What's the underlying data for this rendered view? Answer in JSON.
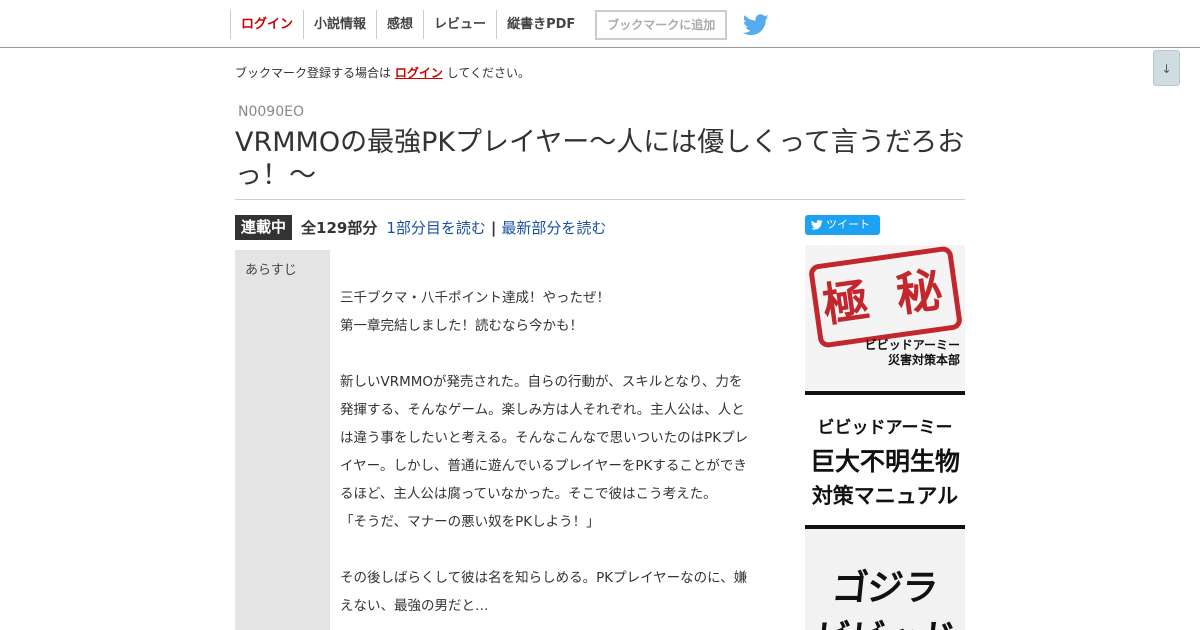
{
  "nav": {
    "items": [
      {
        "label": "ログイン"
      },
      {
        "label": "小説情報"
      },
      {
        "label": "感想"
      },
      {
        "label": "レビュー"
      },
      {
        "label": "縦書きPDF"
      }
    ],
    "bookmark_button": "ブックマークに追加",
    "twitter_icon": "twitter-bird-icon"
  },
  "scroll_button": "↓",
  "notice": {
    "prefix": "ブックマーク登録する場合は",
    "link": "ログイン",
    "suffix": "してください。"
  },
  "novel": {
    "ncode": "N0090EO",
    "title": "VRMMOの最強PKプレイヤー〜人には優しくって言うだろおっ！〜",
    "status": "連載中",
    "total": "全129部分",
    "first_link": "1部分目を読む",
    "separator": "|",
    "latest_link": "最新部分を読む"
  },
  "synopsis": {
    "label": "あらすじ",
    "lines": [
      "三千ブクマ・八千ポイント達成！やったぜ！",
      "第一章完結しました！読むなら今かも！",
      "",
      "新しいVRMMOが発売された。自らの行動が、スキルとなり、力を",
      "発揮する、そんなゲーム。楽しみ方は人それぞれ。主人公は、人と",
      "は違う事をしたいと考える。そんなこんなで思いついたのはPKプレ",
      "イヤー。しかし、普通に遊んでいるプレイヤーをPKすることができ",
      "るほど、主人公は腐っていなかった。そこで彼はこう考えた。",
      "「そうだ、マナーの悪い奴をPKしよう！」",
      "",
      "その後しばらくして彼は名を知らしめる。PKプレイヤーなのに、嫌",
      "えない、最強の男だと…"
    ]
  },
  "tweet_button": "ツイート",
  "ad": {
    "seal": "極 秘",
    "sub1": "ビビッドアーミー",
    "sub2": "災害対策本部",
    "mid_line1": "ビビッドアーミー",
    "mid_line2": "巨大不明生物",
    "mid_line3": "対策マニュアル",
    "bottom_line1": "ゴジラ",
    "bottom_line2": "ビビッド"
  },
  "colors": {
    "login_red": "#cc0000",
    "link_blue": "#1a50a3",
    "twitter_blue": "#1da1f2",
    "badge_dark": "#333333"
  }
}
